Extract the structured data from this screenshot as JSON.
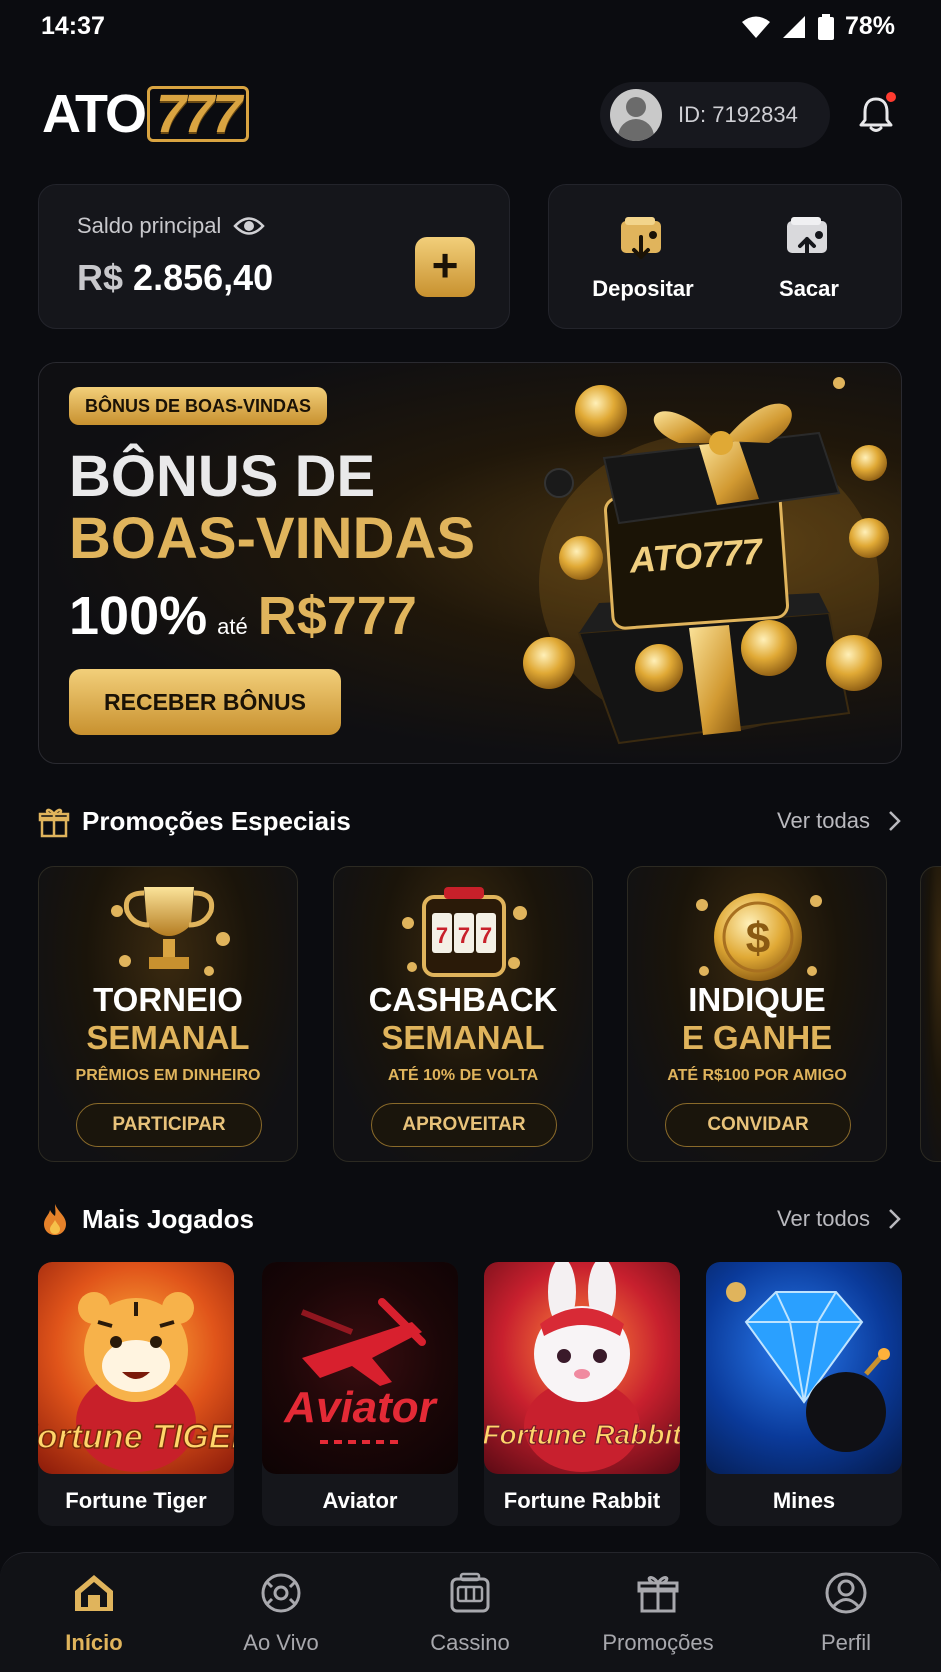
{
  "status_bar": {
    "time": "14:37",
    "battery": "78%"
  },
  "header": {
    "logo_white": "ATO",
    "logo_gold": "777",
    "user_id": "ID: 7192834"
  },
  "balance": {
    "label": "Saldo principal",
    "currency": "R$",
    "amount": "2.856,40"
  },
  "actions": {
    "deposit": "Depositar",
    "withdraw": "Sacar"
  },
  "banner": {
    "badge": "BÔNUS DE BOAS-VINDAS",
    "line1": "BÔNUS DE",
    "line2": "BOAS-VINDAS",
    "percent": "100%",
    "ate": "até",
    "amount": "R$777",
    "cta": "RECEBER BÔNUS",
    "box_logo": "ATO777"
  },
  "promotions": {
    "title": "Promoções Especiais",
    "link": "Ver todas",
    "items": [
      {
        "line1": "TORNEIO",
        "line2": "SEMANAL",
        "sub": "PRÊMIOS EM DINHEIRO",
        "cta": "PARTICIPAR",
        "icon": "trophy-icon"
      },
      {
        "line1": "CASHBACK",
        "line2": "SEMANAL",
        "sub": "ATÉ 10% DE VOLTA",
        "cta": "APROVEITAR",
        "icon": "slot-machine-icon"
      },
      {
        "line1": "INDIQUE",
        "line2": "E GANHE",
        "sub": "ATÉ R$100 POR AMIGO",
        "cta": "CONVIDAR",
        "icon": "coin-icon"
      }
    ]
  },
  "games": {
    "title": "Mais Jogados",
    "link": "Ver todos",
    "items": [
      {
        "name": "Fortune Tiger",
        "art_text": "Fortune TIGER"
      },
      {
        "name": "Aviator",
        "art_text": "Aviator"
      },
      {
        "name": "Fortune Rabbit",
        "art_text": "Fortune Rabbit"
      },
      {
        "name": "Mines",
        "art_text": ""
      }
    ]
  },
  "bottom_nav": [
    {
      "label": "Início",
      "active": true,
      "icon": "home-icon"
    },
    {
      "label": "Ao Vivo",
      "active": false,
      "icon": "live-icon"
    },
    {
      "label": "Cassino",
      "active": false,
      "icon": "casino-icon"
    },
    {
      "label": "Promoções",
      "active": false,
      "icon": "gift-icon"
    },
    {
      "label": "Perfil",
      "active": false,
      "icon": "profile-icon"
    }
  ],
  "colors": {
    "accent": "#e0b45c",
    "background": "#0b0c10",
    "card": "#15161b"
  }
}
